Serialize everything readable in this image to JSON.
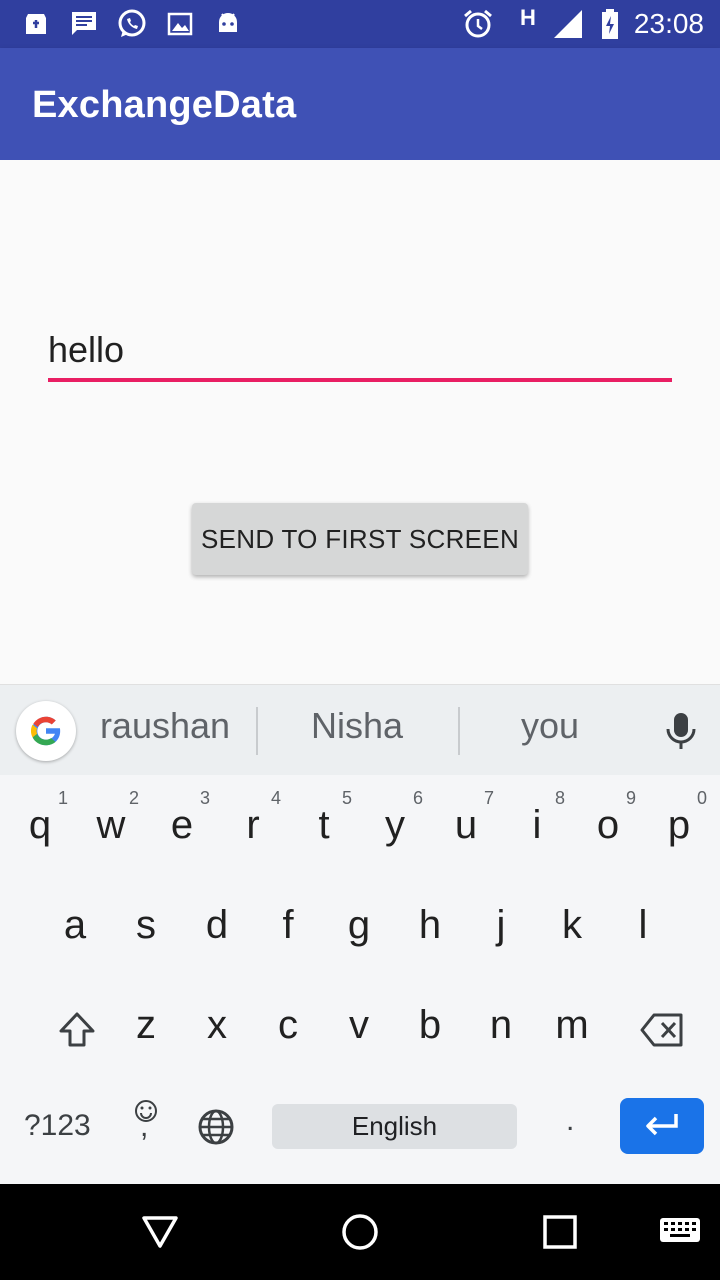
{
  "status_bar": {
    "time": "23:08",
    "network_type": "H",
    "icons_left": [
      "store-icon",
      "message-icon",
      "whatsapp-icon",
      "image-icon",
      "android-icon"
    ],
    "icons_right": [
      "alarm-icon",
      "network-h-icon",
      "signal-icon",
      "battery-charging-icon"
    ]
  },
  "app_bar": {
    "title": "ExchangeData"
  },
  "form": {
    "input_value": "hello",
    "button_label": "SEND TO FIRST SCREEN"
  },
  "keyboard": {
    "suggestions": [
      "raushan",
      "Nisha",
      "you"
    ],
    "row1": [
      {
        "ch": "q",
        "hint": "1"
      },
      {
        "ch": "w",
        "hint": "2"
      },
      {
        "ch": "e",
        "hint": "3"
      },
      {
        "ch": "r",
        "hint": "4"
      },
      {
        "ch": "t",
        "hint": "5"
      },
      {
        "ch": "y",
        "hint": "6"
      },
      {
        "ch": "u",
        "hint": "7"
      },
      {
        "ch": "i",
        "hint": "8"
      },
      {
        "ch": "o",
        "hint": "9"
      },
      {
        "ch": "p",
        "hint": "0"
      }
    ],
    "row2": [
      "a",
      "s",
      "d",
      "f",
      "g",
      "h",
      "j",
      "k",
      "l"
    ],
    "row3": [
      "z",
      "x",
      "c",
      "v",
      "b",
      "n",
      "m"
    ],
    "symbols_label": "?123",
    "comma_label": ",",
    "space_label": "English",
    "period_label": ".",
    "accent_color": "#1a73e8"
  },
  "colors": {
    "status_bar": "#303f9f",
    "app_bar": "#3f51b5",
    "input_underline": "#e91e63"
  }
}
